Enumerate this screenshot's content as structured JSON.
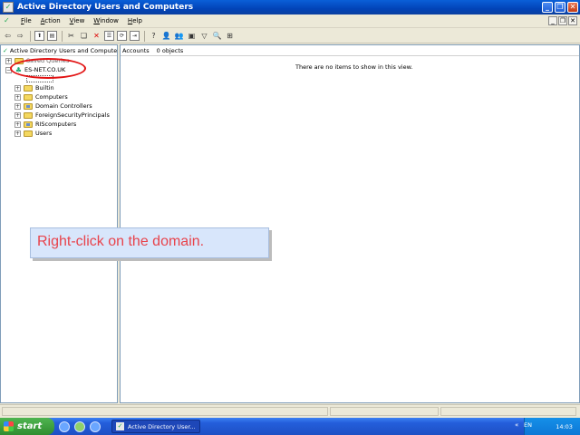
{
  "window": {
    "title": "Active Directory Users and Computers"
  },
  "menu": {
    "items": [
      {
        "accel": "F",
        "rest": "ile"
      },
      {
        "accel": "A",
        "rest": "ction"
      },
      {
        "accel": "V",
        "rest": "iew"
      },
      {
        "accel": "W",
        "rest": "indow"
      },
      {
        "accel": "H",
        "rest": "elp"
      }
    ]
  },
  "left_pane": {
    "header": "Active Directory Users and Computers",
    "saved_queries": "Saved Queries",
    "domain": "ES-NET.CO.UK",
    "children": [
      "Builtin",
      "Computers",
      "Domain Controllers",
      "ForeignSecurityPrincipals",
      "RIScomputers",
      "Users"
    ]
  },
  "right_pane": {
    "header_name": "Accounts",
    "header_count": "0 objects",
    "empty_message": "There are no items to show in this view."
  },
  "caption": {
    "text": "Right-click on the domain."
  },
  "taskbar": {
    "start_label": "start",
    "task_label": "Active Directory User...",
    "language": "EN",
    "clock": "14:03"
  },
  "colors": {
    "annotation": "#e21212",
    "caption_text": "#e8434b",
    "caption_bg": "#d8e6fb"
  }
}
